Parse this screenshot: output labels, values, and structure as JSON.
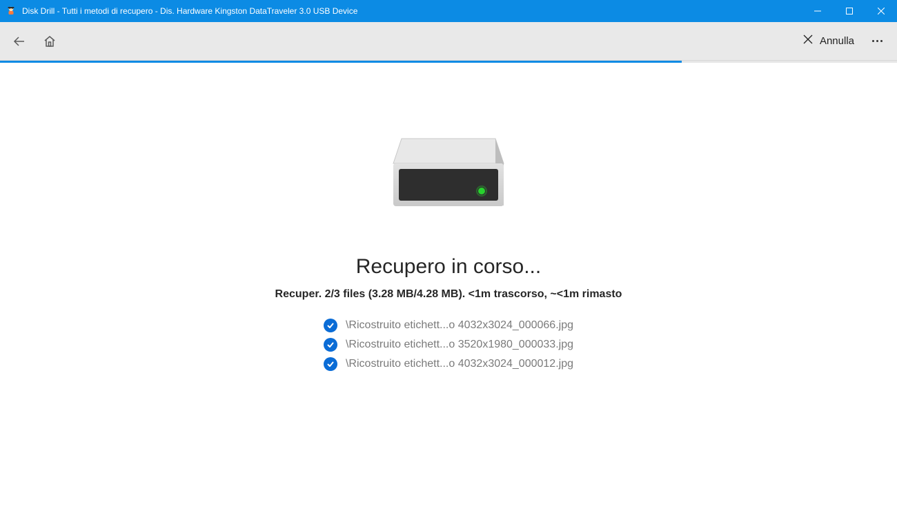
{
  "window": {
    "title": "Disk Drill - Tutti i metodi di recupero - Dis. Hardware Kingston DataTraveler 3.0 USB Device"
  },
  "toolbar": {
    "cancel_label": "Annulla"
  },
  "progress": {
    "percent": 76
  },
  "main": {
    "heading": "Recupero in corso...",
    "status": "Recuper. 2/3 files (3.28 MB/4.28 MB).  <1m trascorso, ~<1m rimasto",
    "files": [
      {
        "name": "\\Ricostruito etichett...o 4032x3024_000066.jpg"
      },
      {
        "name": "\\Ricostruito etichett...o 3520x1980_000033.jpg"
      },
      {
        "name": "\\Ricostruito etichett...o 4032x3024_000012.jpg"
      }
    ]
  },
  "colors": {
    "accent": "#0c8be4",
    "badge": "#0a6cd6"
  }
}
